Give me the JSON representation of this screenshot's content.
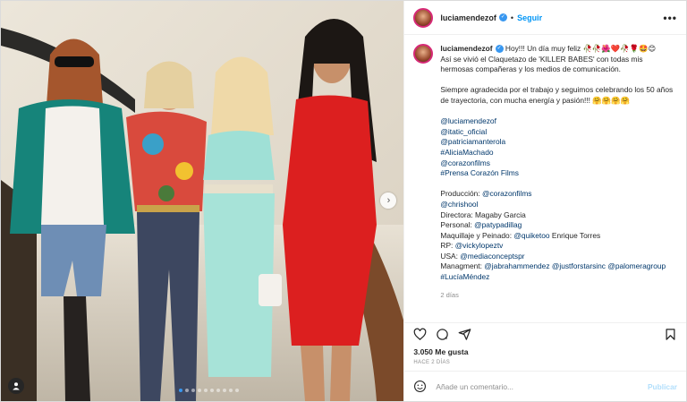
{
  "header": {
    "username": "luciamendezof",
    "separator": "•",
    "follow_label": "Seguir",
    "more_label": "•••"
  },
  "caption": {
    "username": "luciamendezof",
    "line1": "Hoy!!! Un día muy feliz 🥀🥀🌺❤️🥀🌹🤩😊",
    "line2": "Así se vivió el Claquetazo de 'KILLER BABES' con todas mis hermosas compañeras y los medios de comunicación.",
    "line3": "Siempre agradecida por el trabajo y seguimos celebrando los 50 años de trayectoria, con mucha energía y pasión!!! 🤗🤗🤗🤗",
    "tags": [
      "@luciamendezof",
      "@itatic_oficial",
      "@patriciamanterola",
      "#AliciaMachado",
      "@corazonfilms",
      "#Prensa Corazón Films"
    ],
    "credits": [
      {
        "label": "Producción: ",
        "value": "@corazonfilms"
      },
      {
        "label": "",
        "value": "@chrishool"
      },
      {
        "label": "Directora: Magaby Garcia",
        "value": ""
      },
      {
        "label": "Personal: ",
        "value": "@patypadillag"
      },
      {
        "label": "Maquillaje y Peinado: ",
        "value": "@quiketoo",
        "suffix": " Enrique Torres"
      },
      {
        "label": "RP: ",
        "value": "@vickylopeztv"
      },
      {
        "label": "USA: ",
        "value": "@mediaconceptspr"
      },
      {
        "label": "Managment: ",
        "value": "@jabrahammendez @justforstarsinc @palomeragroup"
      },
      {
        "label": "",
        "value": "#LucíaMéndez"
      }
    ],
    "age": "2 días"
  },
  "likes": "3.050 Me gusta",
  "posted": "HACE 2 DÍAS",
  "comment": {
    "placeholder": "Añade un comentario...",
    "publish_label": "Publicar"
  },
  "media": {
    "next_arrow": "›",
    "carousel_total": 10,
    "carousel_active": 1
  },
  "colors": {
    "accent": "#0095f6",
    "link": "#00376b",
    "muted": "#8e8e8e"
  },
  "icons": [
    "heart-icon",
    "comment-icon",
    "share-icon",
    "bookmark-icon",
    "emoji-icon",
    "tag-user-icon",
    "verified-icon"
  ]
}
